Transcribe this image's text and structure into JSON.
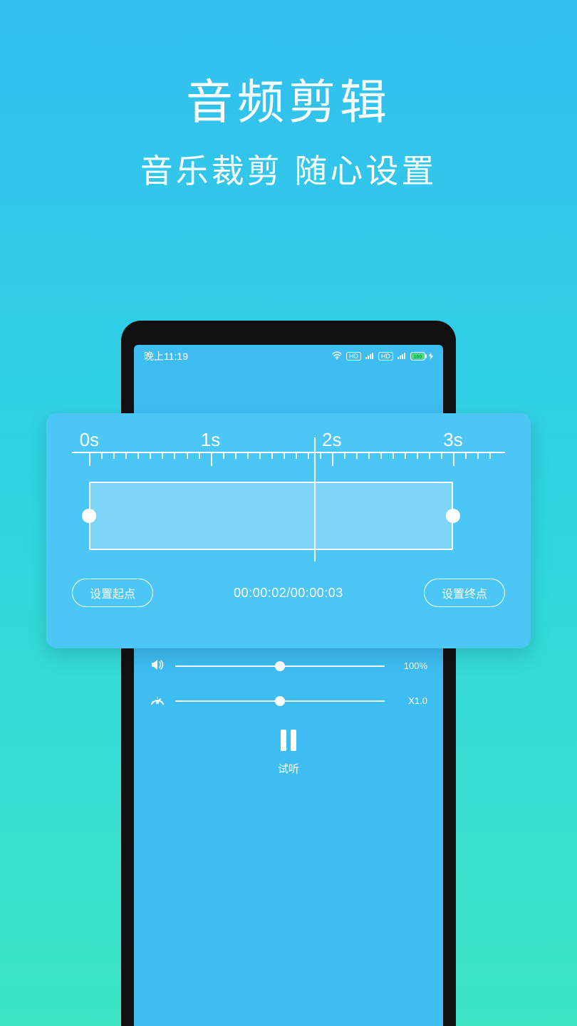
{
  "hero": {
    "title": "音频剪辑",
    "subtitle": "音乐裁剪  随心设置"
  },
  "status": {
    "time": "晚上11:19",
    "battery": "100"
  },
  "ruler": {
    "labels": [
      "0s",
      "1s",
      "2s",
      "3s"
    ]
  },
  "selection": {
    "start_pct": 4,
    "end_pct": 88,
    "playhead_pct": 56
  },
  "controls": {
    "set_start_label": "设置起点",
    "set_end_label": "设置终点",
    "time_readout": "00:00:02/00:00:03"
  },
  "volume": {
    "icon": "volume-icon",
    "value_pct": 50,
    "label": "100%"
  },
  "speed": {
    "icon": "speed-icon",
    "value_pct": 50,
    "label": "X1.0"
  },
  "play": {
    "state_icon": "pause",
    "label": "试听"
  }
}
